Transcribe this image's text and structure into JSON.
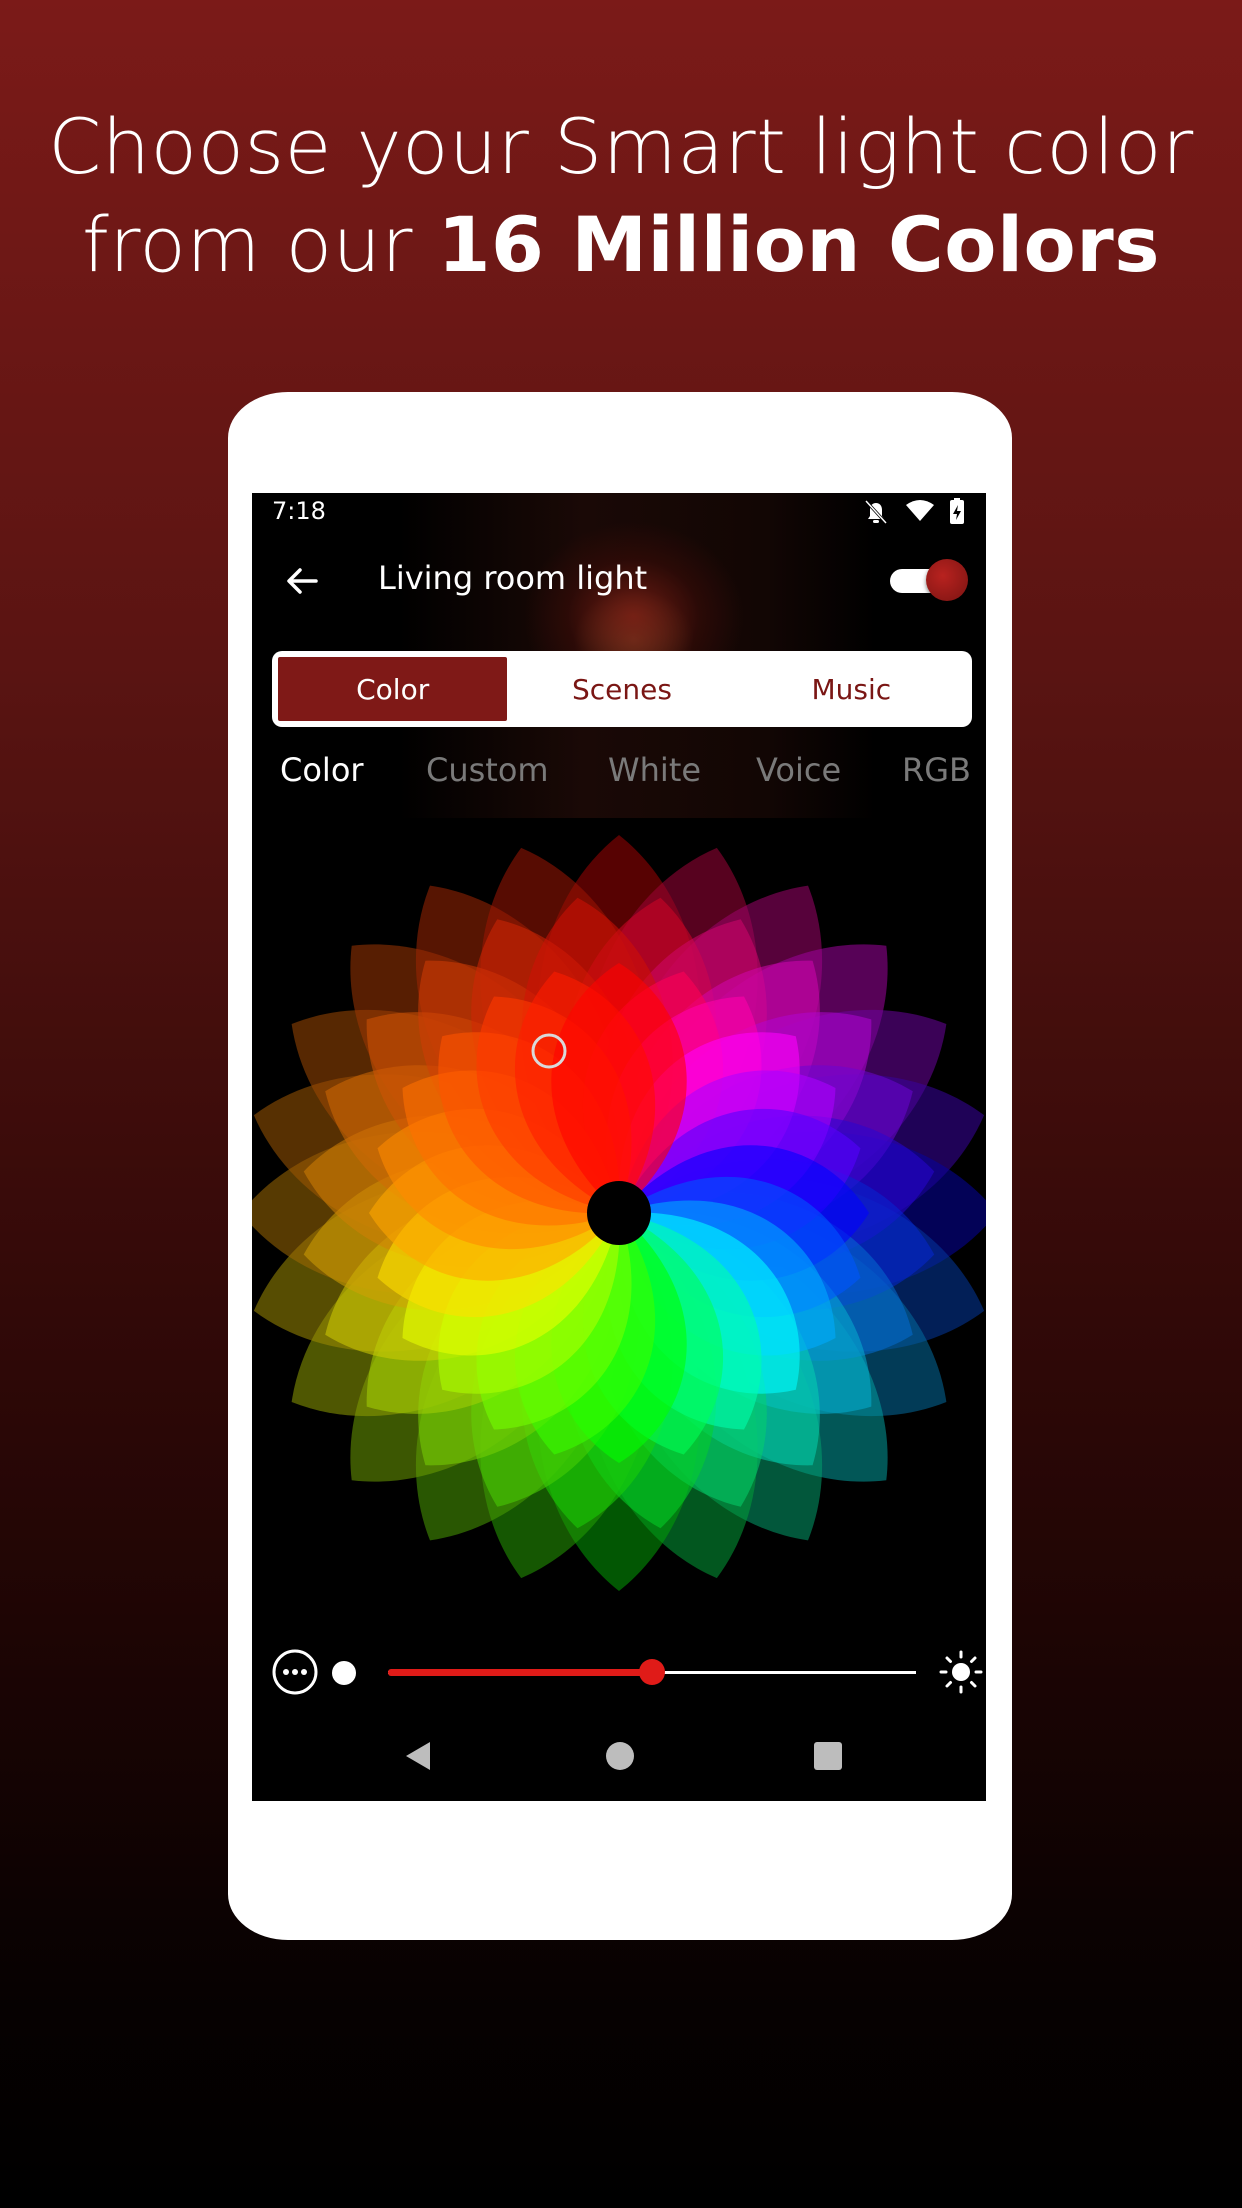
{
  "promo": {
    "line1": "Choose your Smart light color",
    "line2_prefix": "from our ",
    "line2_bold": "16 Million Colors"
  },
  "status": {
    "time": "7:18",
    "icons": [
      "bell-off-icon",
      "wifi-icon",
      "battery-charging-icon"
    ]
  },
  "header": {
    "title": "Living room light",
    "power_on": true
  },
  "segments": [
    {
      "label": "Color",
      "active": true
    },
    {
      "label": "Scenes",
      "active": false
    },
    {
      "label": "Music",
      "active": false
    }
  ],
  "subtabs": [
    {
      "label": "Color",
      "active": true
    },
    {
      "label": "Custom",
      "active": false
    },
    {
      "label": "White",
      "active": false
    },
    {
      "label": "Voice",
      "active": false
    },
    {
      "label": "RGB",
      "active": false
    }
  ],
  "brightness": {
    "fraction": 0.5
  },
  "colors": {
    "accent": "#7f1917",
    "slider": "#e01b18",
    "background_top": "#7b1a18"
  }
}
